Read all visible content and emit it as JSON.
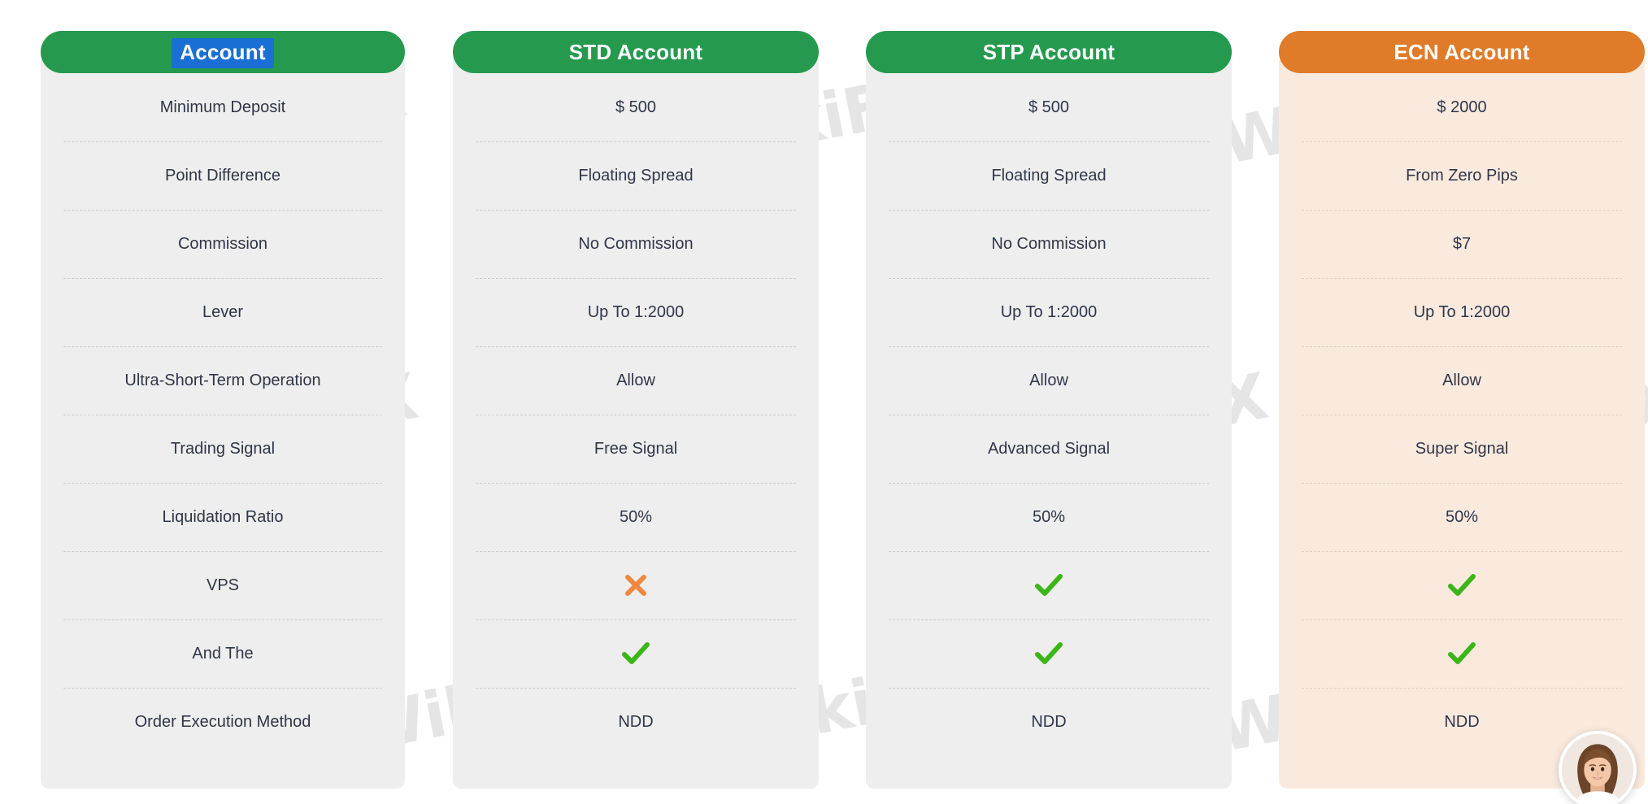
{
  "table": {
    "columns": [
      {
        "key": "labels",
        "header": "Account",
        "header_selected": true,
        "accent": false,
        "cells": [
          {
            "type": "text",
            "value": "Minimum Deposit"
          },
          {
            "type": "text",
            "value": "Point Difference"
          },
          {
            "type": "text",
            "value": "Commission"
          },
          {
            "type": "text",
            "value": "Lever"
          },
          {
            "type": "text",
            "value": "Ultra-Short-Term Operation"
          },
          {
            "type": "text",
            "value": "Trading Signal"
          },
          {
            "type": "text",
            "value": "Liquidation Ratio"
          },
          {
            "type": "text",
            "value": "VPS"
          },
          {
            "type": "text",
            "value": "And The"
          },
          {
            "type": "text",
            "value": "Order Execution Method"
          }
        ]
      },
      {
        "key": "std",
        "header": "STD Account",
        "header_selected": false,
        "accent": false,
        "cells": [
          {
            "type": "text",
            "value": "$ 500"
          },
          {
            "type": "text",
            "value": "Floating Spread"
          },
          {
            "type": "text",
            "value": "No Commission"
          },
          {
            "type": "text",
            "value": "Up To 1:2000"
          },
          {
            "type": "text",
            "value": "Allow"
          },
          {
            "type": "text",
            "value": "Free Signal"
          },
          {
            "type": "text",
            "value": "50%"
          },
          {
            "type": "cross",
            "value": "cross-icon"
          },
          {
            "type": "check",
            "value": "check-icon"
          },
          {
            "type": "text",
            "value": "NDD"
          }
        ]
      },
      {
        "key": "stp",
        "header": "STP Account",
        "header_selected": false,
        "accent": false,
        "cells": [
          {
            "type": "text",
            "value": "$ 500"
          },
          {
            "type": "text",
            "value": "Floating Spread"
          },
          {
            "type": "text",
            "value": "No Commission"
          },
          {
            "type": "text",
            "value": "Up To 1:2000"
          },
          {
            "type": "text",
            "value": "Allow"
          },
          {
            "type": "text",
            "value": "Advanced Signal"
          },
          {
            "type": "text",
            "value": "50%"
          },
          {
            "type": "check",
            "value": "check-icon"
          },
          {
            "type": "check",
            "value": "check-icon"
          },
          {
            "type": "text",
            "value": "NDD"
          }
        ]
      },
      {
        "key": "ecn",
        "header": "ECN Account",
        "header_selected": false,
        "accent": true,
        "cells": [
          {
            "type": "text",
            "value": "$ 2000"
          },
          {
            "type": "text",
            "value": "From Zero Pips"
          },
          {
            "type": "text",
            "value": "$7"
          },
          {
            "type": "text",
            "value": "Up To 1:2000"
          },
          {
            "type": "text",
            "value": "Allow"
          },
          {
            "type": "text",
            "value": "Super Signal"
          },
          {
            "type": "text",
            "value": "50%"
          },
          {
            "type": "check",
            "value": "check-icon"
          },
          {
            "type": "check",
            "value": "check-icon"
          },
          {
            "type": "text",
            "value": "NDD"
          }
        ]
      }
    ]
  },
  "watermark": {
    "text": "WikiFX",
    "logo_name": "wikifx-eagle-logo"
  },
  "chat": {
    "avatar_name": "support-agent-avatar"
  },
  "colors": {
    "header_green": "#259a4e",
    "header_orange": "#e07b29",
    "panel_gray": "#eeeeee",
    "panel_peach": "#faeade",
    "check_green": "#3cb518",
    "cross_orange": "#f0883e",
    "selection_blue": "#1a6fd4",
    "text_dark": "#30374a"
  }
}
